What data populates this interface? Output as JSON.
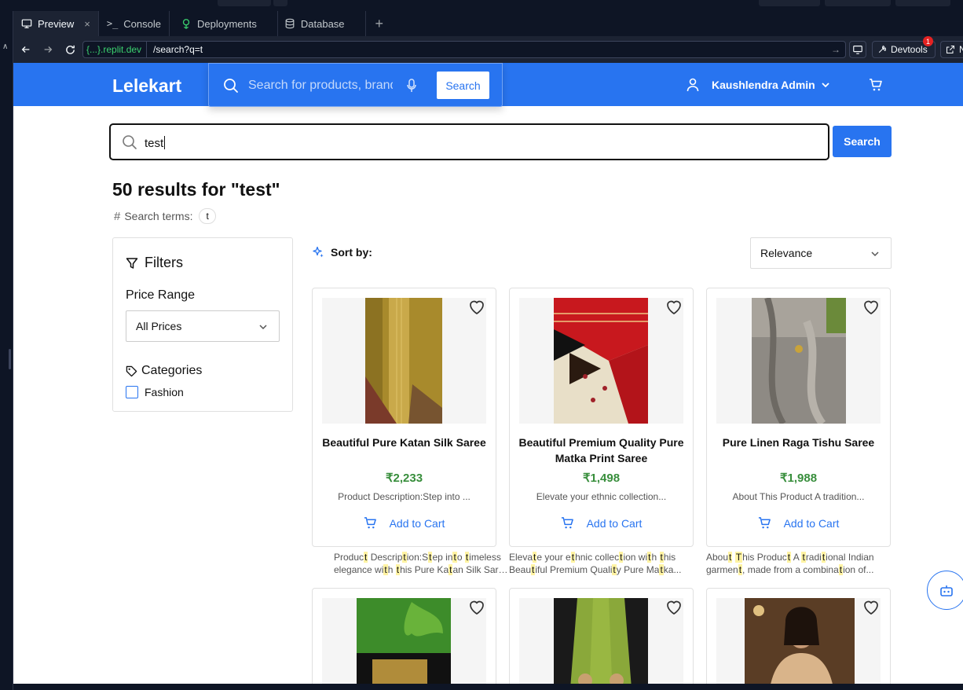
{
  "chrome": {
    "tabs": [
      {
        "label": "Preview",
        "icon": "monitor-icon",
        "active": true,
        "closable": true
      },
      {
        "label": "Console",
        "icon": "terminal-icon"
      },
      {
        "label": "Deployments",
        "icon": "deploy-icon"
      },
      {
        "label": "Database",
        "icon": "database-icon"
      }
    ],
    "url_host": "{...}.replit.dev",
    "url_path": "/search?q=t",
    "devtools_label": "Devtools",
    "devtools_badge": "1",
    "new_tab_label": "N"
  },
  "site": {
    "logo": "Lelekart",
    "header_search_placeholder": "Search for products, brands and more",
    "header_search_button": "Search",
    "user_name": "Kaushlendra Admin",
    "brand_color": "#2874f0"
  },
  "search": {
    "query": "test",
    "button": "Search",
    "results_title": "50 results for \"test\"",
    "terms_label": "Search terms:",
    "term_chip": "t"
  },
  "filters": {
    "title": "Filters",
    "price_label": "Price Range",
    "price_value": "All Prices",
    "categories_label": "Categories",
    "categories": [
      {
        "label": "Fashion",
        "checked": false
      }
    ]
  },
  "sort": {
    "label": "Sort by:",
    "value": "Relevance"
  },
  "products": [
    {
      "name": "Beautiful Pure Katan Silk Saree",
      "price": "₹2,233",
      "desc": "Product Description:Step into ...",
      "add_label": "Add to Cart"
    },
    {
      "name": "Beautiful Premium Quality Pure Matka Print Saree",
      "price": "₹1,498",
      "desc": "Elevate your ethnic collection...",
      "add_label": "Add to Cart"
    },
    {
      "name": "Pure Linen Raga Tishu Saree",
      "price": "₹1,988",
      "desc": "About This Product A tradition...",
      "add_label": "Add to Cart"
    }
  ],
  "snippets": [
    [
      [
        [
          "Produc",
          ""
        ],
        [
          "t",
          "hl"
        ],
        [
          " Descrip",
          ""
        ],
        [
          "t",
          "hl"
        ],
        [
          "ion:S",
          ""
        ],
        [
          "t",
          "hl"
        ],
        [
          "ep in",
          ""
        ],
        [
          "t",
          "hl"
        ],
        [
          "o ",
          ""
        ],
        [
          "t",
          "hl"
        ],
        [
          "imeless",
          ""
        ]
      ],
      [
        [
          "elegance wi",
          ""
        ],
        [
          "t",
          "hl"
        ],
        [
          "h ",
          ""
        ],
        [
          "t",
          "hl"
        ],
        [
          "his Pure Ka",
          ""
        ],
        [
          "t",
          "hl"
        ],
        [
          "an Silk Saree,...",
          ""
        ]
      ]
    ],
    [
      [
        [
          "Eleva",
          ""
        ],
        [
          "t",
          "hl"
        ],
        [
          "e your e",
          ""
        ],
        [
          "t",
          "hl"
        ],
        [
          "hnic collec",
          ""
        ],
        [
          "t",
          "hl"
        ],
        [
          "ion wi",
          ""
        ],
        [
          "t",
          "hl"
        ],
        [
          "h ",
          ""
        ],
        [
          "t",
          "hl"
        ],
        [
          "his",
          ""
        ]
      ],
      [
        [
          "Beau",
          ""
        ],
        [
          "t",
          "hl"
        ],
        [
          "iful Premium Quali",
          ""
        ],
        [
          "t",
          "hl"
        ],
        [
          "y Pure Ma",
          ""
        ],
        [
          "t",
          "hl"
        ],
        [
          "ka...",
          ""
        ]
      ]
    ],
    [
      [
        [
          "Abou",
          ""
        ],
        [
          "t",
          "hl"
        ],
        [
          " ",
          ""
        ],
        [
          "T",
          "hl"
        ],
        [
          "his Produc",
          ""
        ],
        [
          "t",
          "hl"
        ],
        [
          " A ",
          ""
        ],
        [
          "t",
          "hl"
        ],
        [
          "radi",
          ""
        ],
        [
          "t",
          "hl"
        ],
        [
          "ional Indian",
          ""
        ]
      ],
      [
        [
          "garmen",
          ""
        ],
        [
          "t",
          "hl"
        ],
        [
          ", made from a combina",
          ""
        ],
        [
          "t",
          "hl"
        ],
        [
          "ion of...",
          ""
        ]
      ]
    ]
  ]
}
